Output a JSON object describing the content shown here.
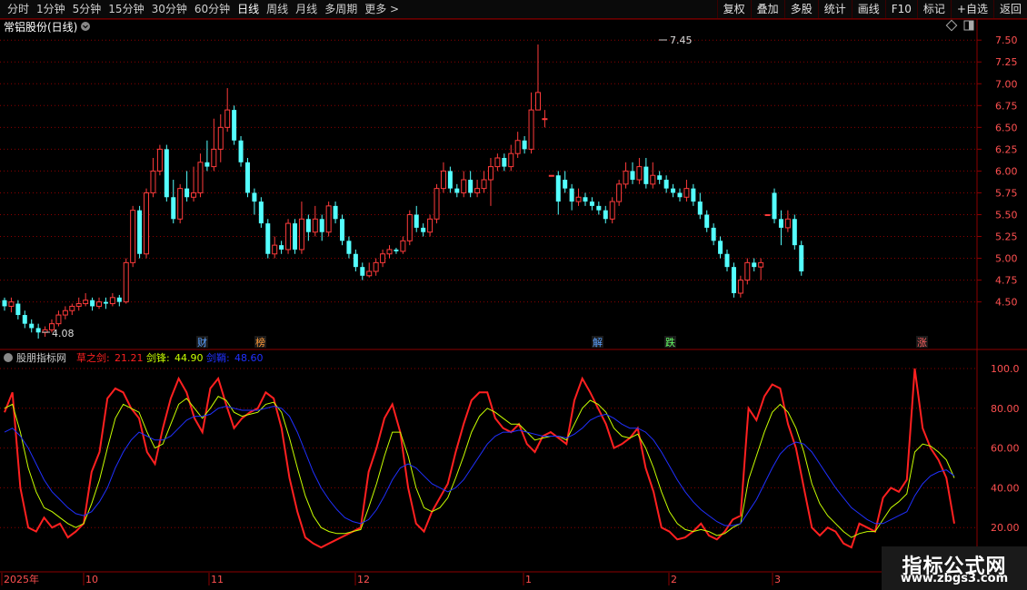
{
  "toolbar": {
    "periods": [
      "分时",
      "1分钟",
      "5分钟",
      "15分钟",
      "30分钟",
      "60分钟",
      "日线",
      "周线",
      "月线",
      "多周期",
      "更多 >"
    ],
    "active_period": "日线",
    "actions": [
      "复权",
      "叠加",
      "多股",
      "统计",
      "画线",
      "F10",
      "标记",
      "+自选",
      "返回"
    ]
  },
  "main_panel": {
    "title": "常铝股份(日线)",
    "high_label": "7.45",
    "low_label": "4.08",
    "markers": [
      "财",
      "榜",
      "解",
      "跌",
      "涨"
    ]
  },
  "indicator_panel": {
    "name": "股朋指标网",
    "line1_label": "草之剑:",
    "line1_value": "21.21",
    "line2_label": "剑锋:",
    "line2_value": "44.90",
    "line3_label": "剑鞘:",
    "line3_value": "48.60"
  },
  "x_axis": {
    "labels": [
      "2025年",
      "10",
      "11",
      "12",
      "1",
      "2",
      "3"
    ]
  },
  "watermark": {
    "title": "指标公式网",
    "url": "www.zbgs3.com"
  },
  "colors": {
    "up": "#ff3b3b",
    "down": "#54ffff",
    "line1": "#ff2020",
    "line2": "#c8ff00",
    "line3": "#2030ff",
    "grid": "#8b0000"
  },
  "chart_data": {
    "type": "candlestick",
    "price_axis": {
      "ticks": [
        4.5,
        4.75,
        5.0,
        5.25,
        5.5,
        5.75,
        6.0,
        6.25,
        6.5,
        6.75,
        7.0,
        7.25,
        7.5
      ],
      "range": [
        4.08,
        7.45
      ]
    },
    "indicator_axis": {
      "ticks": [
        20.0,
        40.0,
        60.0,
        80.0,
        100.0
      ],
      "range": [
        0,
        100
      ]
    },
    "candles": [
      [
        4.52,
        4.45,
        4.55,
        4.4
      ],
      [
        4.45,
        4.5,
        4.55,
        4.38
      ],
      [
        4.48,
        4.35,
        4.52,
        4.3
      ],
      [
        4.35,
        4.25,
        4.4,
        4.2
      ],
      [
        4.25,
        4.2,
        4.3,
        4.15
      ],
      [
        4.2,
        4.15,
        4.25,
        4.08
      ],
      [
        4.15,
        4.18,
        4.22,
        4.1
      ],
      [
        4.18,
        4.25,
        4.3,
        4.15
      ],
      [
        4.25,
        4.35,
        4.4,
        4.22
      ],
      [
        4.35,
        4.4,
        4.45,
        4.3
      ],
      [
        4.4,
        4.45,
        4.48,
        4.35
      ],
      [
        4.45,
        4.48,
        4.55,
        4.4
      ],
      [
        4.48,
        4.52,
        4.6,
        4.45
      ],
      [
        4.52,
        4.45,
        4.55,
        4.4
      ],
      [
        4.45,
        4.5,
        4.55,
        4.42
      ],
      [
        4.5,
        4.48,
        4.55,
        4.42
      ],
      [
        4.48,
        4.55,
        4.6,
        4.45
      ],
      [
        4.55,
        4.5,
        4.58,
        4.45
      ],
      [
        4.5,
        4.95,
        5.0,
        4.48
      ],
      [
        4.95,
        5.55,
        5.6,
        4.9
      ],
      [
        5.55,
        5.05,
        5.6,
        5.0
      ],
      [
        5.05,
        5.75,
        5.8,
        5.0
      ],
      [
        5.75,
        6.0,
        6.15,
        5.7
      ],
      [
        6.0,
        6.25,
        6.3,
        5.95
      ],
      [
        6.25,
        5.7,
        6.3,
        5.65
      ],
      [
        5.7,
        5.45,
        5.9,
        5.4
      ],
      [
        5.45,
        5.8,
        5.85,
        5.4
      ],
      [
        5.8,
        5.7,
        6.0,
        5.65
      ],
      [
        5.7,
        5.75,
        6.05,
        5.65
      ],
      [
        5.75,
        6.1,
        6.2,
        5.7
      ],
      [
        6.1,
        6.05,
        6.35,
        6.0
      ],
      [
        6.05,
        6.25,
        6.6,
        6.0
      ],
      [
        6.25,
        6.5,
        6.65,
        6.1
      ],
      [
        6.5,
        6.7,
        6.95,
        6.45
      ],
      [
        6.7,
        6.35,
        6.75,
        6.3
      ],
      [
        6.35,
        6.1,
        6.4,
        6.05
      ],
      [
        6.1,
        5.75,
        6.15,
        5.7
      ],
      [
        5.75,
        5.65,
        5.8,
        5.5
      ],
      [
        5.65,
        5.4,
        5.7,
        5.35
      ],
      [
        5.4,
        5.05,
        5.45,
        5.0
      ],
      [
        5.05,
        5.15,
        5.25,
        5.0
      ],
      [
        5.15,
        5.1,
        5.2,
        5.05
      ],
      [
        5.1,
        5.4,
        5.45,
        5.05
      ],
      [
        5.4,
        5.1,
        5.45,
        5.05
      ],
      [
        5.1,
        5.45,
        5.65,
        5.05
      ],
      [
        5.45,
        5.3,
        5.5,
        5.2
      ],
      [
        5.3,
        5.45,
        5.6,
        5.25
      ],
      [
        5.45,
        5.3,
        5.5,
        5.2
      ],
      [
        5.3,
        5.6,
        5.65,
        5.25
      ],
      [
        5.6,
        5.45,
        5.65,
        5.4
      ],
      [
        5.45,
        5.2,
        5.5,
        5.15
      ],
      [
        5.2,
        5.05,
        5.25,
        5.0
      ],
      [
        5.05,
        4.9,
        5.1,
        4.85
      ],
      [
        4.9,
        4.8,
        4.95,
        4.75
      ],
      [
        4.8,
        4.85,
        4.95,
        4.78
      ],
      [
        4.85,
        4.95,
        5.0,
        4.8
      ],
      [
        4.95,
        5.05,
        5.1,
        4.9
      ],
      [
        5.05,
        5.1,
        5.15,
        5.0
      ],
      [
        5.1,
        5.08,
        5.12,
        5.05
      ],
      [
        5.08,
        5.2,
        5.25,
        5.05
      ],
      [
        5.2,
        5.5,
        5.55,
        5.15
      ],
      [
        5.5,
        5.35,
        5.6,
        5.3
      ],
      [
        5.35,
        5.3,
        5.4,
        5.25
      ],
      [
        5.3,
        5.45,
        5.5,
        5.25
      ],
      [
        5.45,
        5.8,
        5.85,
        5.4
      ],
      [
        5.8,
        6.0,
        6.1,
        5.75
      ],
      [
        6.0,
        5.8,
        6.05,
        5.75
      ],
      [
        5.8,
        5.75,
        5.85,
        5.7
      ],
      [
        5.75,
        5.9,
        6.0,
        5.7
      ],
      [
        5.9,
        5.75,
        6.0,
        5.7
      ],
      [
        5.75,
        5.8,
        5.9,
        5.7
      ],
      [
        5.8,
        5.9,
        6.0,
        5.75
      ],
      [
        5.9,
        6.05,
        6.15,
        5.6
      ],
      [
        6.05,
        6.15,
        6.2,
        6.0
      ],
      [
        6.15,
        6.05,
        6.2,
        6.0
      ],
      [
        6.05,
        6.2,
        6.3,
        6.0
      ],
      [
        6.2,
        6.35,
        6.45,
        6.15
      ],
      [
        6.35,
        6.25,
        6.4,
        6.2
      ],
      [
        6.25,
        6.7,
        6.9,
        6.2
      ],
      [
        6.7,
        6.9,
        7.45,
        6.85
      ],
      [
        6.6,
        6.6,
        6.7,
        6.5
      ],
      [
        5.95,
        5.95,
        5.95,
        5.95
      ],
      [
        5.95,
        5.65,
        6.0,
        5.5
      ],
      [
        5.9,
        5.8,
        6.0,
        5.75
      ],
      [
        5.8,
        5.65,
        5.85,
        5.55
      ],
      [
        5.65,
        5.7,
        5.8,
        5.6
      ],
      [
        5.7,
        5.65,
        5.75,
        5.6
      ],
      [
        5.65,
        5.6,
        5.7,
        5.55
      ],
      [
        5.6,
        5.55,
        5.65,
        5.5
      ],
      [
        5.55,
        5.45,
        5.6,
        5.4
      ],
      [
        5.45,
        5.65,
        5.7,
        5.4
      ],
      [
        5.65,
        5.85,
        5.9,
        5.6
      ],
      [
        5.85,
        6.0,
        6.1,
        5.8
      ],
      [
        6.0,
        5.9,
        6.1,
        5.85
      ],
      [
        5.9,
        6.05,
        6.15,
        5.85
      ],
      [
        6.05,
        5.85,
        6.15,
        5.8
      ],
      [
        5.85,
        5.95,
        6.1,
        5.8
      ],
      [
        5.95,
        5.9,
        6.0,
        5.85
      ],
      [
        5.9,
        5.8,
        5.95,
        5.75
      ],
      [
        5.8,
        5.75,
        5.85,
        5.7
      ],
      [
        5.75,
        5.7,
        5.8,
        5.65
      ],
      [
        5.7,
        5.8,
        5.9,
        5.65
      ],
      [
        5.8,
        5.65,
        5.85,
        5.6
      ],
      [
        5.65,
        5.5,
        5.75,
        5.45
      ],
      [
        5.5,
        5.35,
        5.55,
        5.3
      ],
      [
        5.35,
        5.2,
        5.4,
        5.15
      ],
      [
        5.2,
        5.05,
        5.25,
        5.0
      ],
      [
        5.05,
        4.9,
        5.1,
        4.85
      ],
      [
        4.9,
        4.6,
        4.95,
        4.55
      ],
      [
        4.6,
        4.75,
        4.8,
        4.55
      ],
      [
        4.75,
        4.95,
        5.0,
        4.7
      ],
      [
        4.95,
        4.9,
        5.0,
        4.85
      ],
      [
        4.9,
        4.95,
        5.0,
        4.75
      ],
      [
        5.5,
        5.5,
        5.5,
        5.5
      ],
      [
        5.75,
        5.45,
        5.8,
        5.4
      ],
      [
        5.45,
        5.35,
        5.55,
        5.15
      ],
      [
        5.35,
        5.45,
        5.55,
        5.3
      ],
      [
        5.45,
        5.15,
        5.5,
        5.1
      ],
      [
        5.15,
        4.85,
        5.2,
        4.8
      ]
    ],
    "series": [
      {
        "name": "草之剑",
        "values": [
          78,
          88,
          40,
          20,
          18,
          25,
          20,
          22,
          15,
          18,
          22,
          48,
          58,
          85,
          90,
          88,
          80,
          75,
          58,
          52,
          70,
          85,
          95,
          88,
          75,
          68,
          90,
          95,
          82,
          70,
          75,
          78,
          80,
          88,
          85,
          70,
          45,
          28,
          15,
          12,
          10,
          12,
          14,
          16,
          18,
          20,
          48,
          60,
          75,
          82,
          68,
          40,
          22,
          18,
          28,
          35,
          42,
          58,
          72,
          84,
          88,
          88,
          75,
          70,
          68,
          72,
          62,
          58,
          66,
          68,
          65,
          62,
          84,
          95,
          88,
          80,
          72,
          60,
          62,
          65,
          70,
          50,
          38,
          20,
          18,
          14,
          15,
          18,
          22,
          16,
          14,
          18,
          24,
          26,
          80,
          74,
          86,
          92,
          90,
          72,
          60,
          40,
          20,
          16,
          20,
          18,
          12,
          10,
          22,
          20,
          18,
          35,
          40,
          38,
          44,
          100,
          70,
          60,
          54,
          45,
          22
        ]
      },
      {
        "name": "剑锋",
        "values": [
          80,
          82,
          68,
          50,
          38,
          30,
          28,
          25,
          22,
          20,
          22,
          32,
          44,
          60,
          75,
          82,
          80,
          78,
          68,
          60,
          62,
          72,
          82,
          85,
          80,
          75,
          80,
          86,
          84,
          78,
          76,
          77,
          78,
          82,
          83,
          78,
          65,
          50,
          36,
          26,
          20,
          18,
          17,
          17,
          18,
          19,
          30,
          42,
          56,
          68,
          68,
          56,
          40,
          30,
          28,
          30,
          35,
          45,
          56,
          68,
          76,
          80,
          78,
          75,
          72,
          72,
          68,
          64,
          65,
          66,
          66,
          64,
          72,
          80,
          84,
          82,
          78,
          70,
          66,
          65,
          67,
          60,
          50,
          38,
          28,
          22,
          19,
          18,
          19,
          18,
          16,
          17,
          20,
          22,
          44,
          56,
          68,
          78,
          82,
          78,
          70,
          58,
          42,
          32,
          26,
          22,
          18,
          15,
          17,
          18,
          18,
          24,
          30,
          33,
          37,
          58,
          62,
          61,
          58,
          54,
          45
        ]
      },
      {
        "name": "剑鞘",
        "values": [
          68,
          70,
          66,
          60,
          52,
          44,
          38,
          34,
          30,
          27,
          26,
          28,
          33,
          40,
          50,
          58,
          64,
          68,
          66,
          64,
          64,
          66,
          70,
          74,
          76,
          76,
          77,
          80,
          81,
          80,
          79,
          79,
          79,
          80,
          81,
          80,
          76,
          68,
          58,
          48,
          40,
          34,
          29,
          25,
          23,
          22,
          24,
          29,
          36,
          44,
          50,
          52,
          50,
          46,
          42,
          40,
          38,
          40,
          44,
          50,
          56,
          62,
          66,
          68,
          68,
          69,
          68,
          67,
          66,
          66,
          66,
          65,
          67,
          70,
          74,
          76,
          77,
          75,
          72,
          70,
          70,
          68,
          64,
          58,
          51,
          44,
          38,
          33,
          29,
          26,
          23,
          21,
          21,
          22,
          28,
          34,
          42,
          50,
          57,
          61,
          63,
          62,
          58,
          52,
          46,
          40,
          35,
          30,
          27,
          24,
          22,
          22,
          24,
          26,
          28,
          36,
          42,
          46,
          48,
          49,
          46
        ]
      }
    ]
  }
}
